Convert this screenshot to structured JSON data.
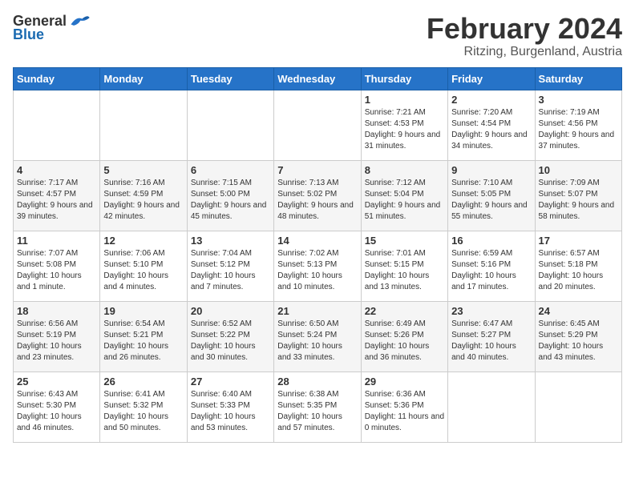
{
  "logo": {
    "general": "General",
    "blue": "Blue"
  },
  "title": "February 2024",
  "subtitle": "Ritzing, Burgenland, Austria",
  "days_of_week": [
    "Sunday",
    "Monday",
    "Tuesday",
    "Wednesday",
    "Thursday",
    "Friday",
    "Saturday"
  ],
  "weeks": [
    [
      {
        "day": "",
        "info": ""
      },
      {
        "day": "",
        "info": ""
      },
      {
        "day": "",
        "info": ""
      },
      {
        "day": "",
        "info": ""
      },
      {
        "day": "1",
        "info": "Sunrise: 7:21 AM\nSunset: 4:53 PM\nDaylight: 9 hours and 31 minutes."
      },
      {
        "day": "2",
        "info": "Sunrise: 7:20 AM\nSunset: 4:54 PM\nDaylight: 9 hours and 34 minutes."
      },
      {
        "day": "3",
        "info": "Sunrise: 7:19 AM\nSunset: 4:56 PM\nDaylight: 9 hours and 37 minutes."
      }
    ],
    [
      {
        "day": "4",
        "info": "Sunrise: 7:17 AM\nSunset: 4:57 PM\nDaylight: 9 hours and 39 minutes."
      },
      {
        "day": "5",
        "info": "Sunrise: 7:16 AM\nSunset: 4:59 PM\nDaylight: 9 hours and 42 minutes."
      },
      {
        "day": "6",
        "info": "Sunrise: 7:15 AM\nSunset: 5:00 PM\nDaylight: 9 hours and 45 minutes."
      },
      {
        "day": "7",
        "info": "Sunrise: 7:13 AM\nSunset: 5:02 PM\nDaylight: 9 hours and 48 minutes."
      },
      {
        "day": "8",
        "info": "Sunrise: 7:12 AM\nSunset: 5:04 PM\nDaylight: 9 hours and 51 minutes."
      },
      {
        "day": "9",
        "info": "Sunrise: 7:10 AM\nSunset: 5:05 PM\nDaylight: 9 hours and 55 minutes."
      },
      {
        "day": "10",
        "info": "Sunrise: 7:09 AM\nSunset: 5:07 PM\nDaylight: 9 hours and 58 minutes."
      }
    ],
    [
      {
        "day": "11",
        "info": "Sunrise: 7:07 AM\nSunset: 5:08 PM\nDaylight: 10 hours and 1 minute."
      },
      {
        "day": "12",
        "info": "Sunrise: 7:06 AM\nSunset: 5:10 PM\nDaylight: 10 hours and 4 minutes."
      },
      {
        "day": "13",
        "info": "Sunrise: 7:04 AM\nSunset: 5:12 PM\nDaylight: 10 hours and 7 minutes."
      },
      {
        "day": "14",
        "info": "Sunrise: 7:02 AM\nSunset: 5:13 PM\nDaylight: 10 hours and 10 minutes."
      },
      {
        "day": "15",
        "info": "Sunrise: 7:01 AM\nSunset: 5:15 PM\nDaylight: 10 hours and 13 minutes."
      },
      {
        "day": "16",
        "info": "Sunrise: 6:59 AM\nSunset: 5:16 PM\nDaylight: 10 hours and 17 minutes."
      },
      {
        "day": "17",
        "info": "Sunrise: 6:57 AM\nSunset: 5:18 PM\nDaylight: 10 hours and 20 minutes."
      }
    ],
    [
      {
        "day": "18",
        "info": "Sunrise: 6:56 AM\nSunset: 5:19 PM\nDaylight: 10 hours and 23 minutes."
      },
      {
        "day": "19",
        "info": "Sunrise: 6:54 AM\nSunset: 5:21 PM\nDaylight: 10 hours and 26 minutes."
      },
      {
        "day": "20",
        "info": "Sunrise: 6:52 AM\nSunset: 5:22 PM\nDaylight: 10 hours and 30 minutes."
      },
      {
        "day": "21",
        "info": "Sunrise: 6:50 AM\nSunset: 5:24 PM\nDaylight: 10 hours and 33 minutes."
      },
      {
        "day": "22",
        "info": "Sunrise: 6:49 AM\nSunset: 5:26 PM\nDaylight: 10 hours and 36 minutes."
      },
      {
        "day": "23",
        "info": "Sunrise: 6:47 AM\nSunset: 5:27 PM\nDaylight: 10 hours and 40 minutes."
      },
      {
        "day": "24",
        "info": "Sunrise: 6:45 AM\nSunset: 5:29 PM\nDaylight: 10 hours and 43 minutes."
      }
    ],
    [
      {
        "day": "25",
        "info": "Sunrise: 6:43 AM\nSunset: 5:30 PM\nDaylight: 10 hours and 46 minutes."
      },
      {
        "day": "26",
        "info": "Sunrise: 6:41 AM\nSunset: 5:32 PM\nDaylight: 10 hours and 50 minutes."
      },
      {
        "day": "27",
        "info": "Sunrise: 6:40 AM\nSunset: 5:33 PM\nDaylight: 10 hours and 53 minutes."
      },
      {
        "day": "28",
        "info": "Sunrise: 6:38 AM\nSunset: 5:35 PM\nDaylight: 10 hours and 57 minutes."
      },
      {
        "day": "29",
        "info": "Sunrise: 6:36 AM\nSunset: 5:36 PM\nDaylight: 11 hours and 0 minutes."
      },
      {
        "day": "",
        "info": ""
      },
      {
        "day": "",
        "info": ""
      }
    ]
  ]
}
